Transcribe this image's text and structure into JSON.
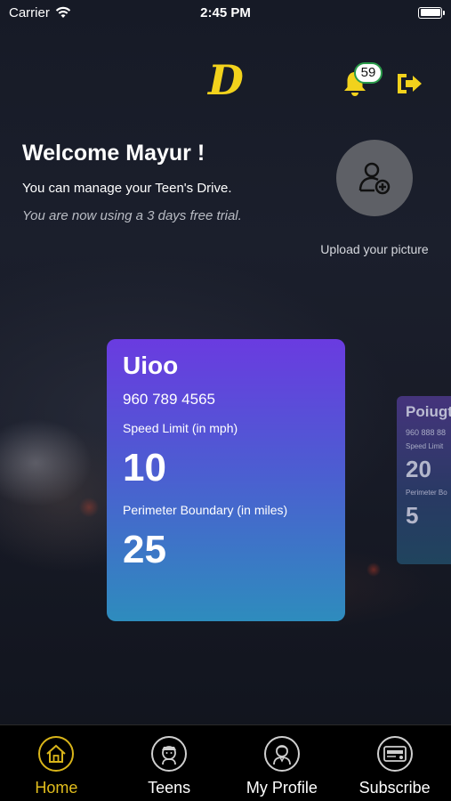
{
  "status_bar": {
    "carrier": "Carrier",
    "time": "2:45 PM"
  },
  "header": {
    "logo_text": "D",
    "notification_count": "59"
  },
  "welcome": {
    "title": "Welcome Mayur !",
    "subtitle": "You can manage your Teen's Drive.",
    "trial": "You are now using a 3 days free trial."
  },
  "avatar": {
    "upload_label": "Upload your picture"
  },
  "teens": [
    {
      "name": "Uioo",
      "phone": "960 789 4565",
      "speed_label": "Speed Limit (in mph)",
      "speed_value": "10",
      "perimeter_label": "Perimeter Boundary (in miles)",
      "perimeter_value": "25"
    },
    {
      "name": "Poiugt",
      "phone": "960 888 88",
      "speed_label": "Speed Limit",
      "speed_value": "20",
      "perimeter_label": "Perimeter Bo",
      "perimeter_value": "5"
    }
  ],
  "tabs": [
    {
      "label": "Home",
      "icon": "home-icon",
      "active": true
    },
    {
      "label": "Teens",
      "icon": "teen-icon",
      "active": false
    },
    {
      "label": "My Profile",
      "icon": "profile-icon",
      "active": false
    },
    {
      "label": "Subscribe",
      "icon": "subscribe-icon",
      "active": false
    }
  ],
  "colors": {
    "accent": "#F2D21C",
    "badge_border": "#2A9C4A",
    "card_top": "#6A3BE0",
    "card_bottom": "#2E8CBD"
  }
}
